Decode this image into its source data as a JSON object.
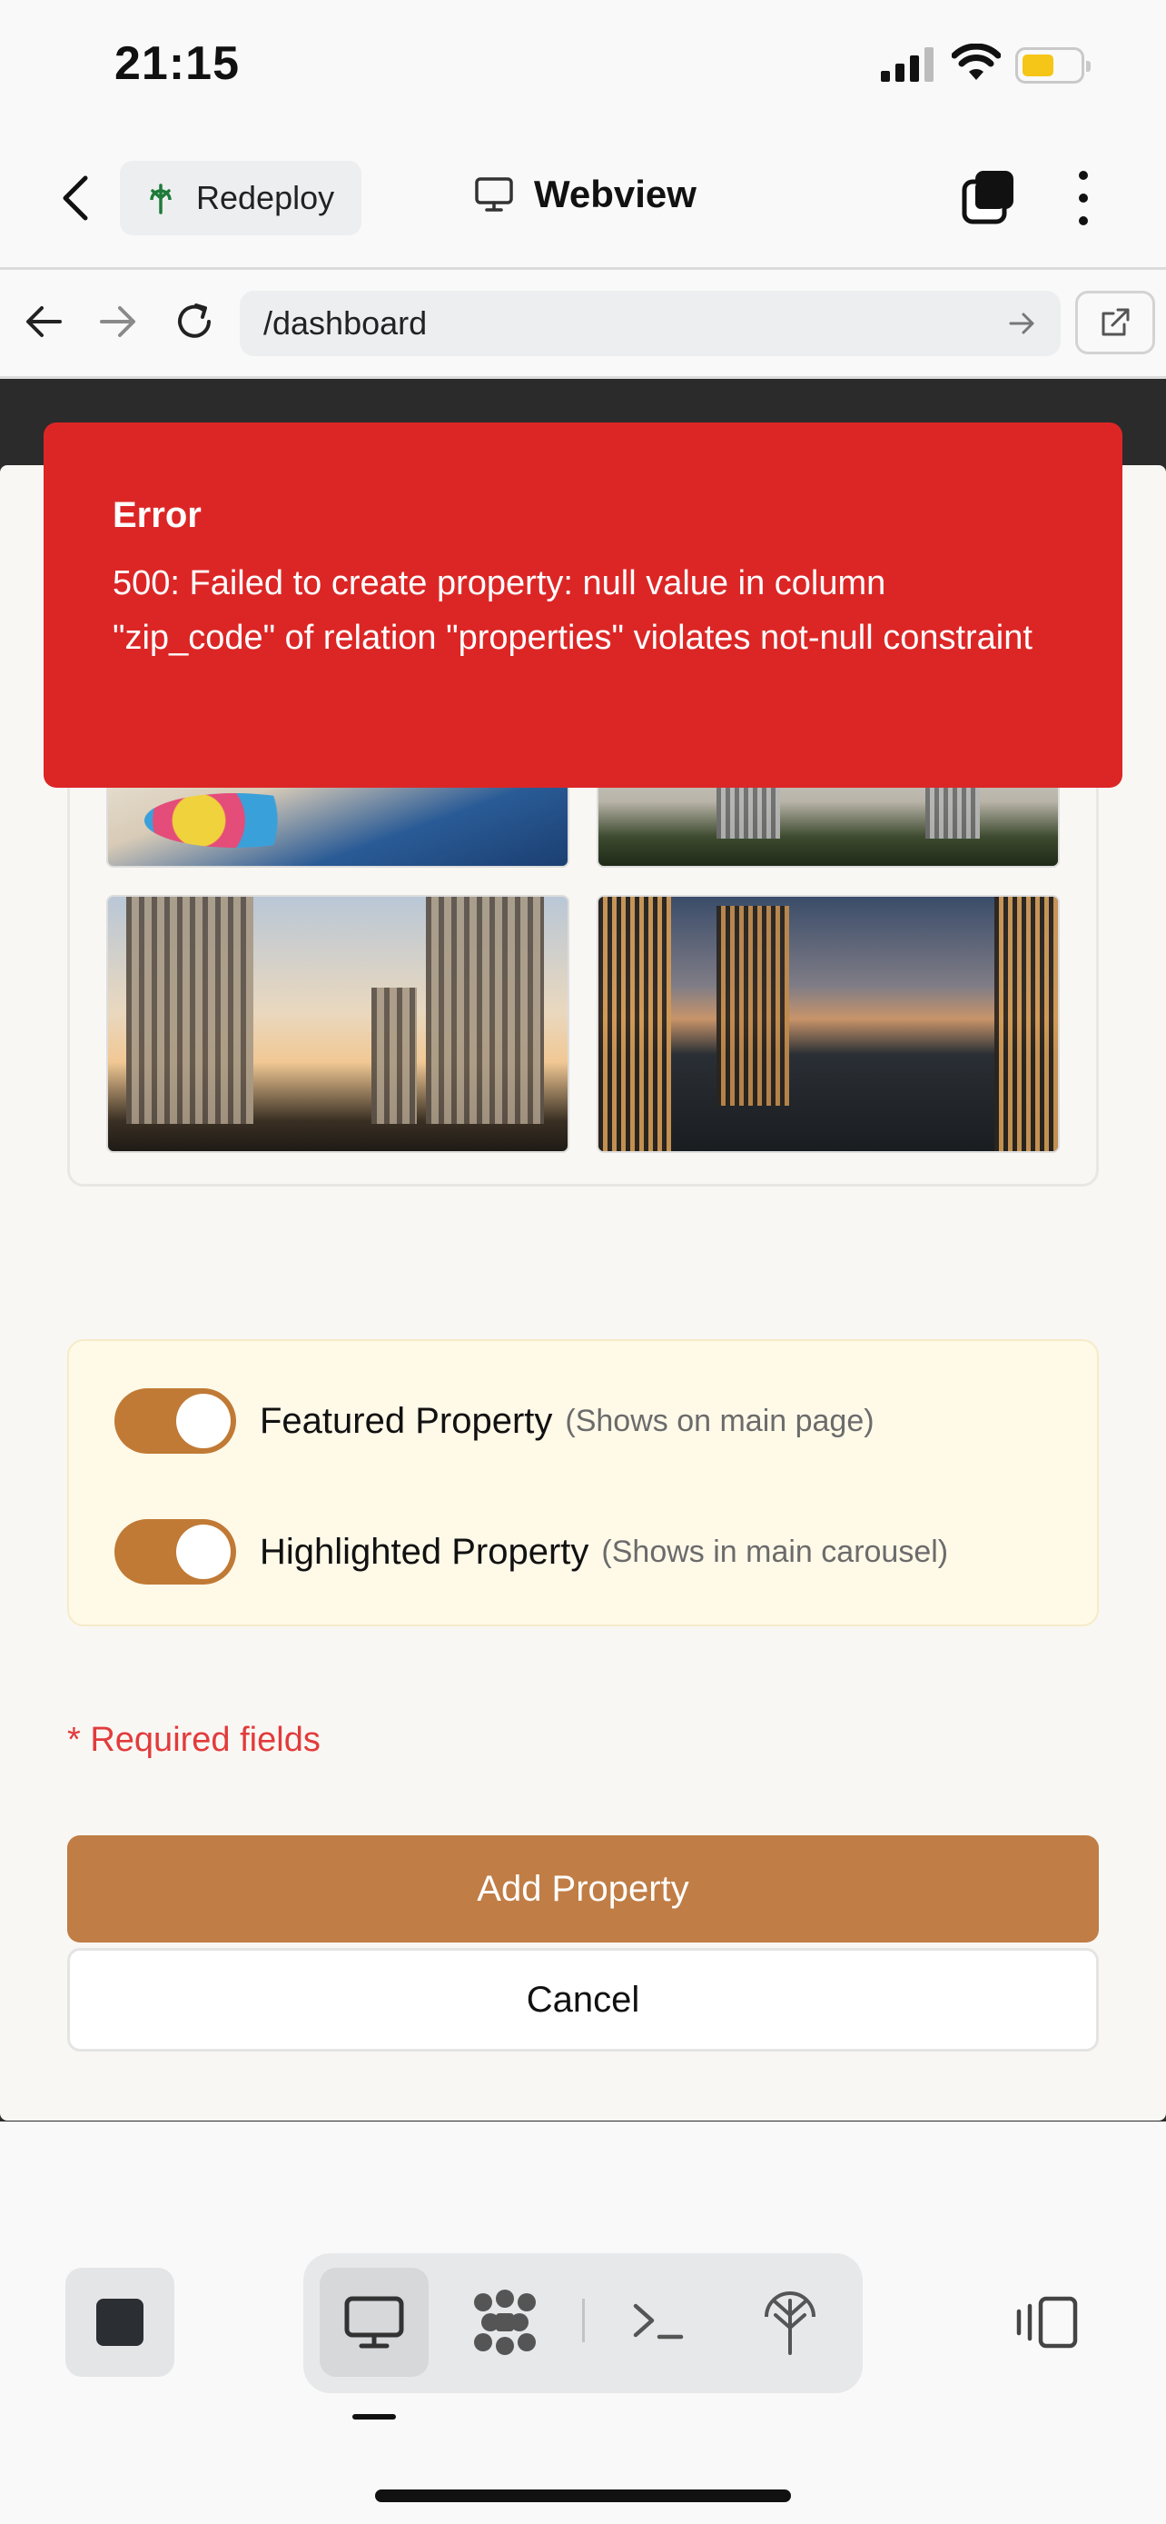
{
  "status_bar": {
    "time": "21:15"
  },
  "header": {
    "redeploy_label": "Redeploy",
    "title": "Webview"
  },
  "browser": {
    "url": "/dashboard"
  },
  "error_toast": {
    "title": "Error",
    "message": "500: Failed to create property: null value in column \"zip_code\" of relation \"properties\" violates not-null constraint"
  },
  "form": {
    "toggles": [
      {
        "label": "Featured Property",
        "hint": "(Shows on main page)",
        "on": true
      },
      {
        "label": "Highlighted Property",
        "hint": "(Shows in main carousel)",
        "on": true
      }
    ],
    "required_note": "* Required fields",
    "submit_label": "Add Property",
    "cancel_label": "Cancel"
  },
  "colors": {
    "error": "#dc2626",
    "accent": "#c07d45",
    "toggle": "#c07a35",
    "required": "#e23b3b"
  }
}
